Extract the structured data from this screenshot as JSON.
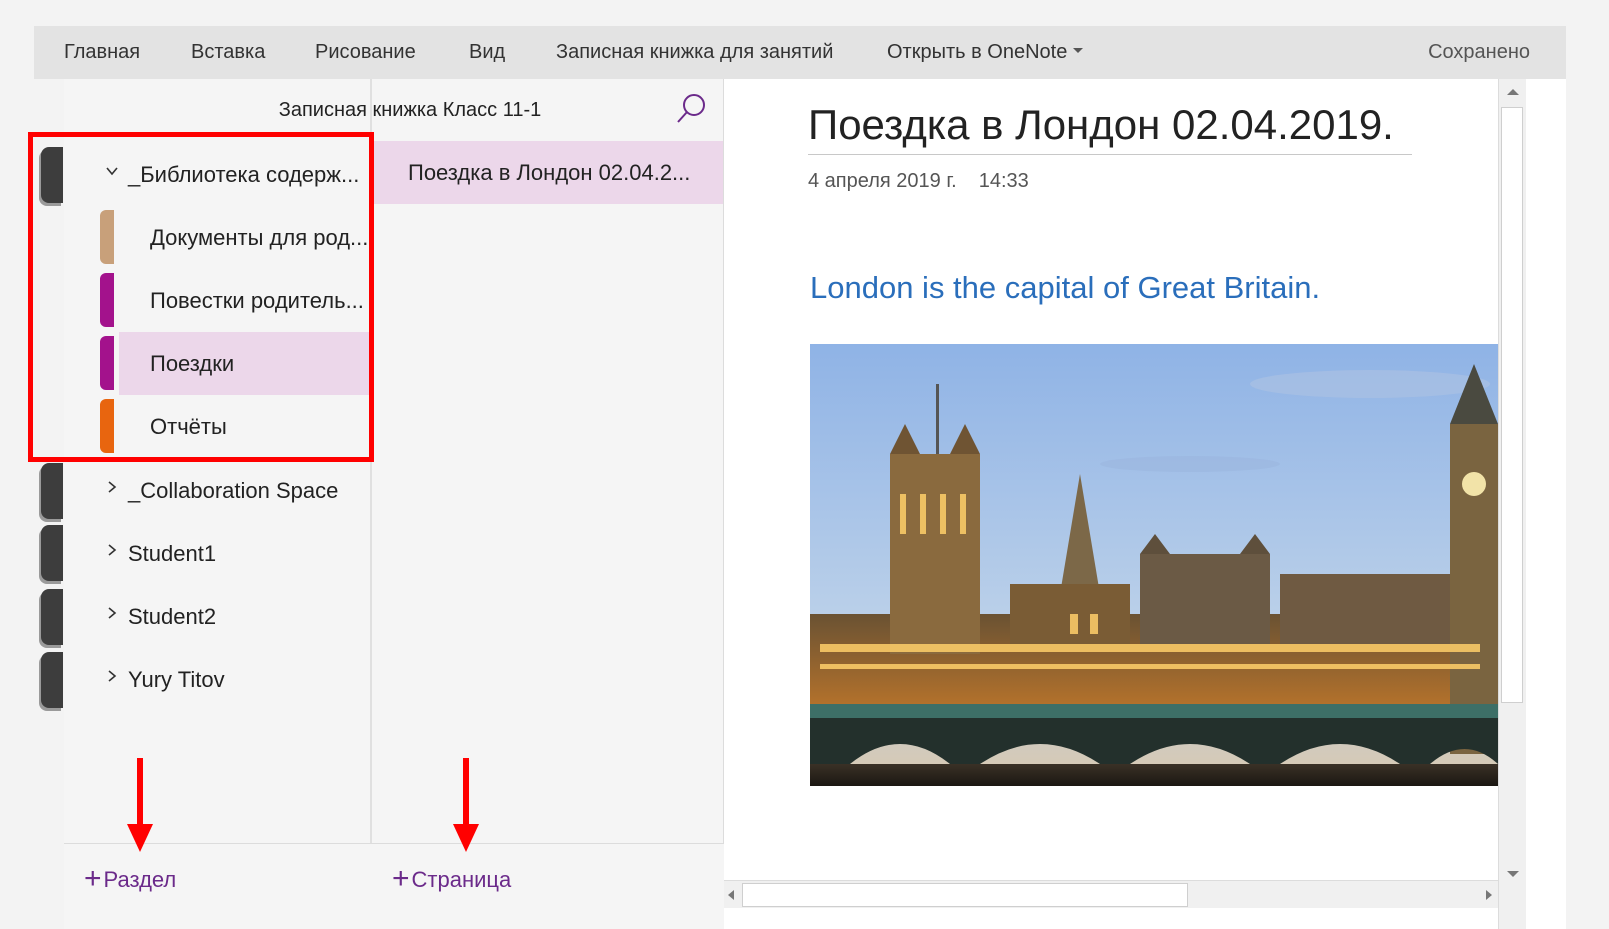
{
  "ribbon": {
    "tabs": [
      "Главная",
      "Вставка",
      "Рисование",
      "Вид",
      "Записная книжка для занятий",
      "Открыть в OneNote"
    ],
    "status": "Сохранено"
  },
  "notebook": {
    "title": "Записная книжка Класс 11-1"
  },
  "sections": {
    "parent": "_Библиотека содерж...",
    "children": [
      {
        "label": "Документы для род...",
        "color": "#c8a07a"
      },
      {
        "label": "Повестки родитель...",
        "color": "#a3128c"
      },
      {
        "label": "Поездки",
        "color": "#a3128c",
        "selected": true
      },
      {
        "label": "Отчёты",
        "color": "#e8650f"
      }
    ],
    "groups": [
      "_Collaboration Space",
      "Student1",
      "Student2",
      "Yury Titov"
    ],
    "add_label": "Раздел"
  },
  "pages": {
    "items": [
      "Поездка в Лондон 02.04.2..."
    ],
    "add_label": "Страница"
  },
  "page": {
    "title": "Поездка в Лондон 02.04.2019.",
    "date": "4 апреля 2019 г.",
    "time": "14:33",
    "body": "London is the capital of Great Britain."
  },
  "colors": {
    "accent": "#6b2a8a",
    "selection": "#ecd7ea",
    "annotation": "#ff0000",
    "link_blue": "#2a6ebb"
  }
}
